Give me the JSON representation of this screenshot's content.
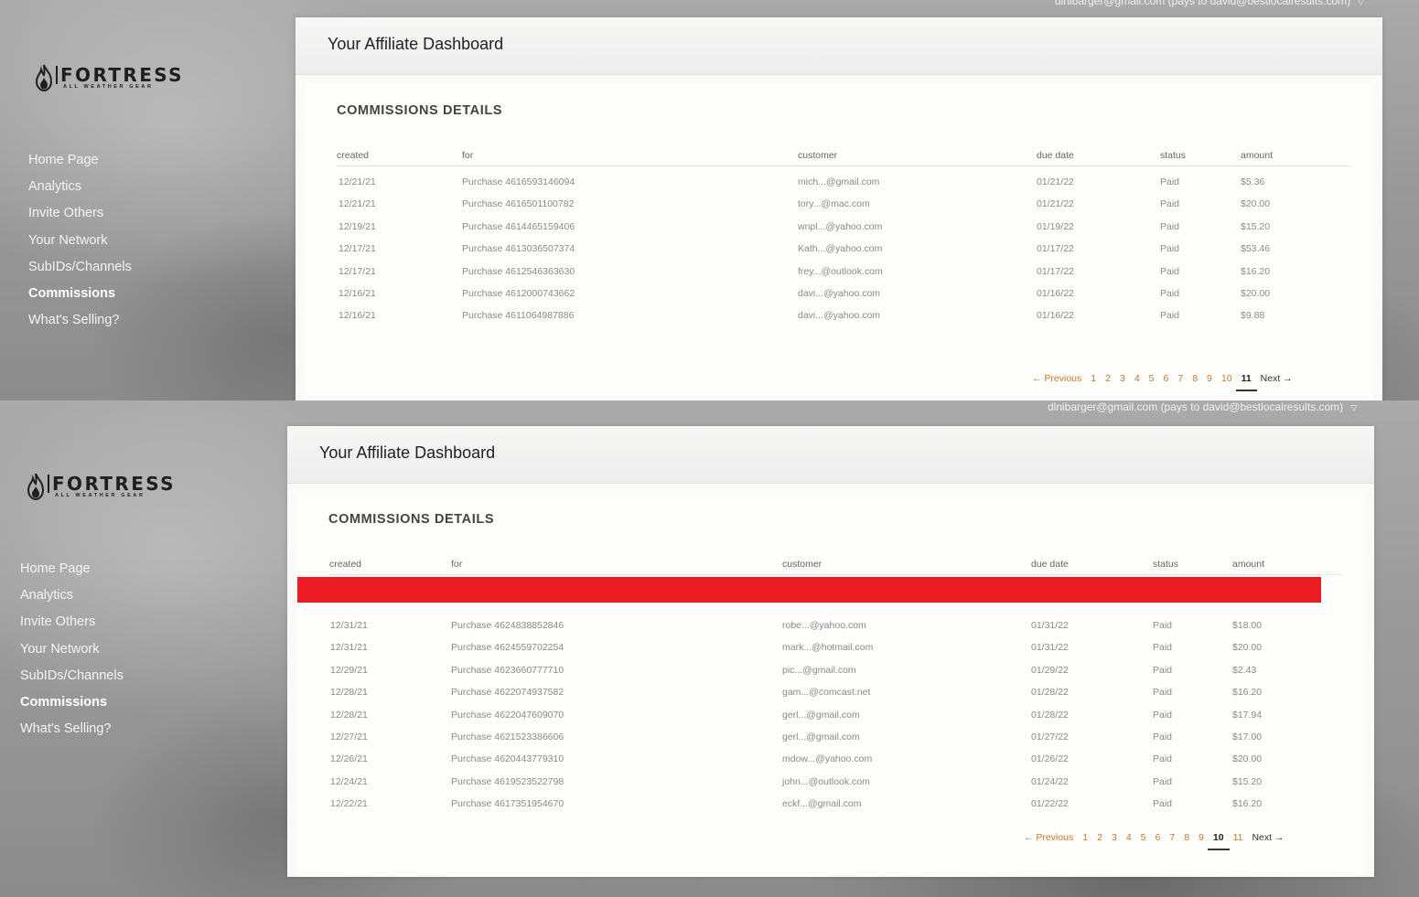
{
  "sidebar": {
    "logo": {
      "brand": "FORTRESS",
      "tagline": "ALL WEATHER GEAR"
    },
    "items": [
      {
        "label": "Home Page",
        "active": false
      },
      {
        "label": "Analytics",
        "active": false
      },
      {
        "label": "Invite Others",
        "active": false
      },
      {
        "label": "Your Network",
        "active": false
      },
      {
        "label": "SubIDs/Channels",
        "active": false
      },
      {
        "label": "Commissions",
        "active": true
      },
      {
        "label": "What's Selling?",
        "active": false
      }
    ]
  },
  "account": {
    "top_partial": "dlnibarger@gmail.com (pays to david@bestlocalresults.com)",
    "label": "dlnibarger@gmail.com (pays to david@bestlocalresults.com)",
    "chevron": "▽"
  },
  "colors": {
    "accent": "#c8782a",
    "censor": "#ed1c24",
    "active_underline": "#333333"
  },
  "screens": [
    {
      "card_title": "Your Affiliate Dashboard",
      "section_title": "COMMISSIONS DETAILS",
      "columns": [
        "created",
        "for",
        "customer",
        "due date",
        "status",
        "amount"
      ],
      "rows": [
        [
          "12/21/21",
          "Purchase 4616593146094",
          "mich...@gmail.com",
          "01/21/22",
          "Paid",
          "$5.36"
        ],
        [
          "12/21/21",
          "Purchase 4616501100782",
          "tory...@mac.com",
          "01/21/22",
          "Paid",
          "$20.00"
        ],
        [
          "12/19/21",
          "Purchase 4614465159406",
          "wnpl...@yahoo.com",
          "01/19/22",
          "Paid",
          "$15.20"
        ],
        [
          "12/17/21",
          "Purchase 4613036507374",
          "Kath...@yahoo.com",
          "01/17/22",
          "Paid",
          "$53.46"
        ],
        [
          "12/17/21",
          "Purchase 4612546363630",
          "frey...@outlook.com",
          "01/17/22",
          "Paid",
          "$16.20"
        ],
        [
          "12/16/21",
          "Purchase 4612000743662",
          "davi...@yahoo.com",
          "01/16/22",
          "Paid",
          "$20.00"
        ],
        [
          "12/16/21",
          "Purchase 4611064987886",
          "davi...@yahoo.com",
          "01/16/22",
          "Paid",
          "$9.88"
        ]
      ],
      "pagination": {
        "previous": "← Previous",
        "pages": [
          "1",
          "2",
          "3",
          "4",
          "5",
          "6",
          "7",
          "8",
          "9",
          "10",
          "11"
        ],
        "current": "11",
        "next": "Next →"
      }
    },
    {
      "card_title": "Your Affiliate Dashboard",
      "section_title": "COMMISSIONS DETAILS",
      "columns": [
        "created",
        "for",
        "customer",
        "due date",
        "status",
        "amount"
      ],
      "rows": [
        [
          "12/31/21",
          "Purchase 4624838852846",
          "robe...@yahoo.com",
          "01/31/22",
          "Paid",
          "$18.00"
        ],
        [
          "12/31/21",
          "Purchase 4624559702254",
          "mark...@hotmail.com",
          "01/31/22",
          "Paid",
          "$20.00"
        ],
        [
          "12/29/21",
          "Purchase 4623660777710",
          "pic...@gmail.com",
          "01/29/22",
          "Paid",
          "$2.43"
        ],
        [
          "12/28/21",
          "Purchase 4622074937582",
          "gam...@comcast.net",
          "01/28/22",
          "Paid",
          "$16.20"
        ],
        [
          "12/28/21",
          "Purchase 4622047609070",
          "gerl...@gmail.com",
          "01/28/22",
          "Paid",
          "$17.94"
        ],
        [
          "12/27/21",
          "Purchase 4621523386606",
          "gerl...@gmail.com",
          "01/27/22",
          "Paid",
          "$17.00"
        ],
        [
          "12/26/21",
          "Purchase 4620443779310",
          "mdow...@yahoo.com",
          "01/26/22",
          "Paid",
          "$20.00"
        ],
        [
          "12/24/21",
          "Purchase 4619523522798",
          "john...@outlook.com",
          "01/24/22",
          "Paid",
          "$15.20"
        ],
        [
          "12/22/21",
          "Purchase 4617351954670",
          "eckf...@gmail.com",
          "01/22/22",
          "Paid",
          "$16.20"
        ]
      ],
      "pagination": {
        "previous": "← Previous",
        "pages": [
          "1",
          "2",
          "3",
          "4",
          "5",
          "6",
          "7",
          "8",
          "9",
          "10",
          "11"
        ],
        "current": "10",
        "next": "Next →"
      }
    }
  ]
}
